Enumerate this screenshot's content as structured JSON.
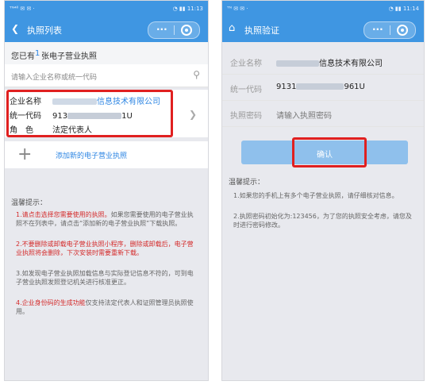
{
  "left": {
    "status_left": "ᵀᴺ⁴ˡˡ ✉ ✉ ·",
    "status_right": "◔ ▮▮ 11:13",
    "nav_title": "执照列表",
    "summary_pre": "您已有",
    "summary_count": "1",
    "summary_post": "张电子营业执照",
    "search_placeholder": "请输入企业名称或统一代码",
    "card": {
      "name_label": "企业名称",
      "name_value": "信息技术有限公司",
      "code_label": "统一代码",
      "code_prefix": "913",
      "code_suffix": "1U",
      "role_label": "角　色",
      "role_value": "法定代表人"
    },
    "add_label": "添加新的电子营业执照",
    "tips_title": "温馨提示：",
    "tips": [
      {
        "red": "1.请点击选择您需要使用的执照。",
        "rest": "如果您需要使用的电子营业执照不在列表中，请点击“添加新的电子营业执照”下载执照。"
      },
      {
        "red": "2.不要删除或卸载电子营业执照小程序，删除或卸载后，电子营业执照将会删除，下次安装时需要重新下载。",
        "rest": ""
      },
      {
        "red": "",
        "rest": "3.如发现电子营业执照加载信息与实际登记信息不符的，可到电子营业执照发照登记机关进行核准更正。"
      },
      {
        "red": "4.企业身份码的生成功能",
        "rest": "仅支持法定代表人和证照管理员执照使用。"
      }
    ]
  },
  "right": {
    "status_left": "ᵀᴺ ✉ ✉ ·",
    "status_right": "◔ ▮▮ 11:14",
    "nav_title": "执照验证",
    "fields": [
      {
        "label": "企业名称",
        "value": "信息技术有限公司"
      },
      {
        "label": "统一代码",
        "value_prefix": "9131",
        "value_suffix": "961U"
      },
      {
        "label": "执照密码",
        "placeholder": "请输入执照密码"
      }
    ],
    "confirm_label": "确认",
    "tips_title": "温馨提示：",
    "tips": [
      "1.如果您的手机上有多个电子营业执照，请仔细核对信息。",
      "2.执照密码初始化为:123456，为了您的执照安全考虑，请您及时进行密码修改。"
    ]
  },
  "colors": {
    "brand": "#3f96e2",
    "highlight": "#e02020",
    "link": "#2e86e3"
  },
  "icons": [
    "back-arrow-icon",
    "more-dots-icon",
    "target-icon",
    "search-icon",
    "chevron-right-icon",
    "plus-icon",
    "home-icon"
  ]
}
